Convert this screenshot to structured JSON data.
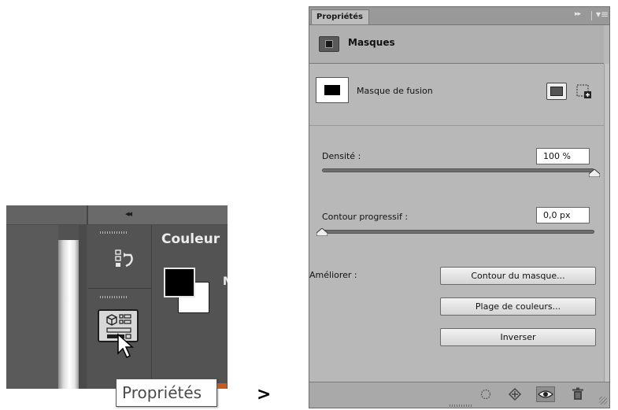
{
  "left_panel": {
    "panel_title": "Couleur",
    "partial_label": "M",
    "collapse_glyph": "◂◂",
    "icons": [
      "history-icon",
      "properties-icon",
      "cursor-icon"
    ]
  },
  "tooltip": {
    "text": "Propriétés"
  },
  "separator": ">",
  "properties": {
    "tab_label": "Propriétés",
    "tab_controls": "▸▸",
    "menu_glyph": "▾≡",
    "header_title": "Masques",
    "mask_label": "Masque de fusion",
    "density": {
      "label": "Densité :",
      "value": "100 %",
      "level": 1.0
    },
    "feather": {
      "label": "Contour progressif :",
      "value": "0,0 px",
      "level": 0.0
    },
    "refine_label": "Améliorer :",
    "buttons": {
      "mask_edge": "Contour du masque...",
      "color_range": "Plage de couleurs...",
      "invert": "Inverser"
    },
    "footer_icons": [
      "selection-icon",
      "apply-mask-icon",
      "visibility-icon",
      "trash-icon"
    ]
  }
}
